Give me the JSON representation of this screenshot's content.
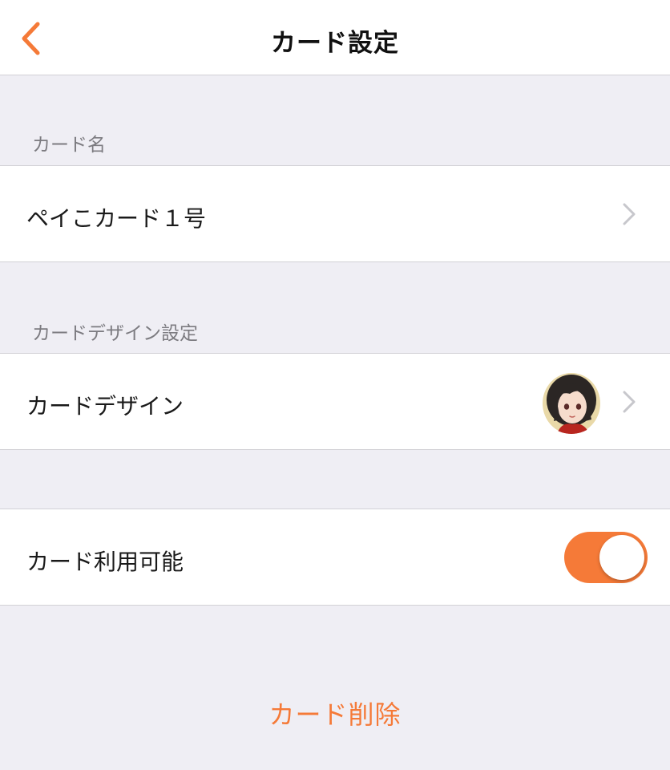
{
  "colors": {
    "accent": "#f57a38",
    "background": "#efeef4",
    "chevron": "#c7c7cc"
  },
  "navbar": {
    "back_icon": "chevron-left-icon",
    "title": "カード設定"
  },
  "sections": {
    "card_name_header": "カード名",
    "card_design_header": "カードデザイン設定"
  },
  "card_name": {
    "value": "ペイこカード１号",
    "icon": "chevron-right-icon"
  },
  "card_design": {
    "label": "カードデザイン",
    "thumbnail": "character-avatar",
    "icon": "chevron-right-icon"
  },
  "card_enabled": {
    "label": "カード利用可能",
    "on": true
  },
  "delete_label": "カード削除"
}
